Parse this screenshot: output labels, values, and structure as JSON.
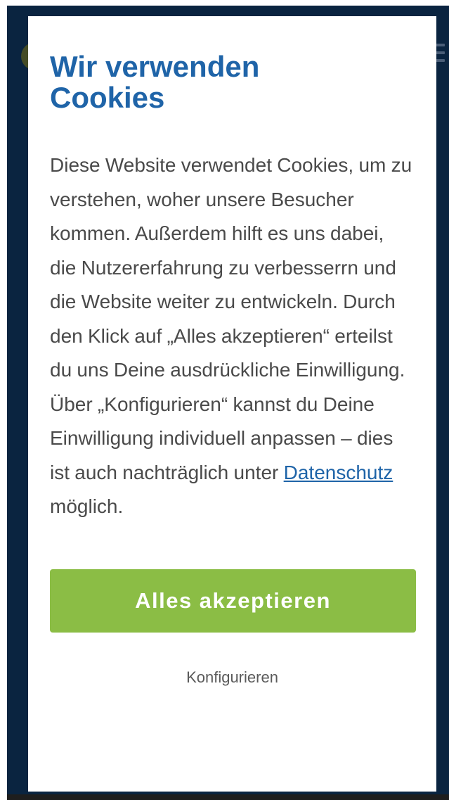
{
  "background": {
    "color": "#0a2440"
  },
  "cookie_banner": {
    "title_line1": "Wir verwenden",
    "title_line2": "Cookies",
    "body_text_before_link": "Diese Website verwendet Cookies, um zu verstehen, woher unsere Besucher kommen. Außerdem hilft es uns dabei, die Nutzererfahrung zu verbesserrn und die Website weiter zu entwickeln. Durch den Klick auf „Alles akzeptieren“ erteilst du uns Deine ausdrückliche Einwilligung. Über „Konfigurieren“ kannst du Deine Einwilligung individuell anpassen – dies ist auch nachträglich unter",
    "privacy_link_label": "Datenschutz",
    "body_text_after_link": "möglich.",
    "accept_button_label": "Alles akzeptieren",
    "configure_button_label": "Konfigurieren",
    "colors": {
      "title": "#1f64a8",
      "link": "#1f64a8",
      "accept_button": "#8bbd45",
      "body_text": "#4a4a4a"
    }
  }
}
